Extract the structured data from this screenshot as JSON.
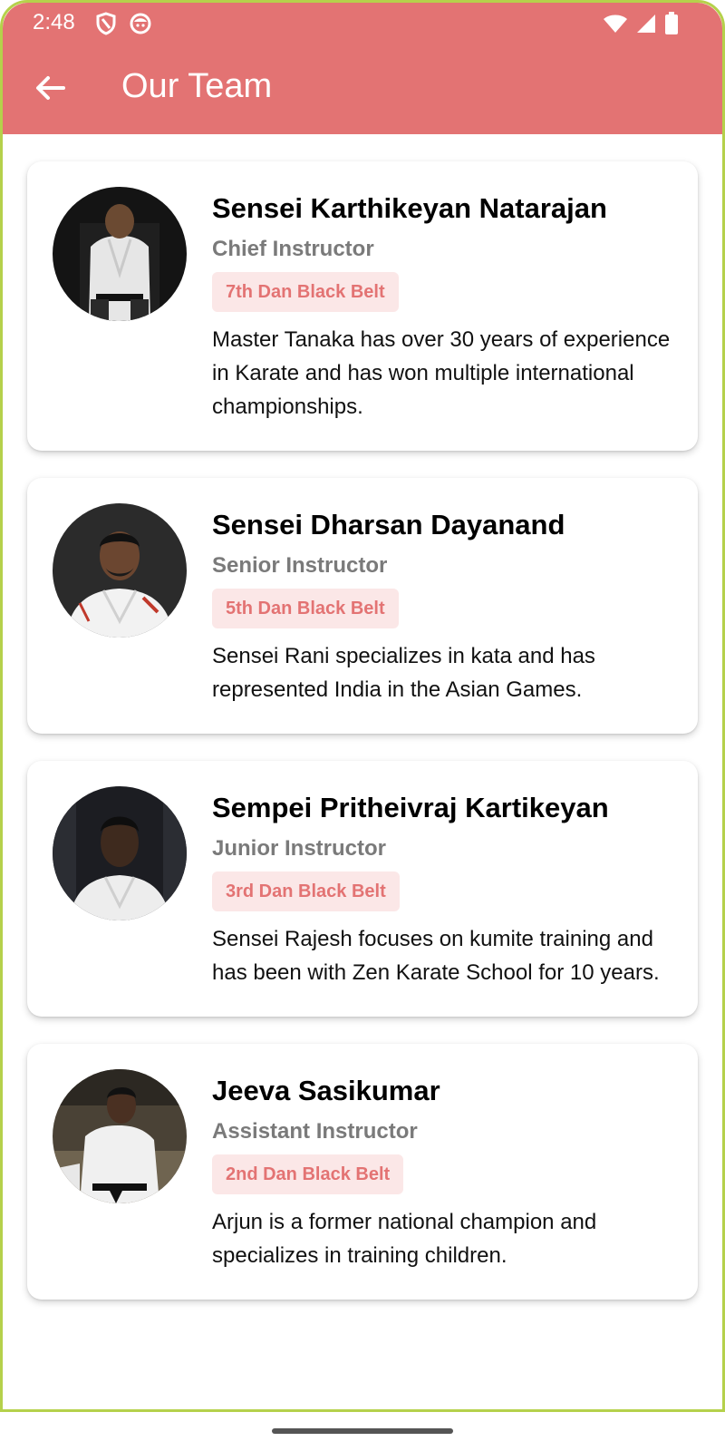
{
  "status_bar": {
    "time": "2:48",
    "icons": [
      "shield-icon",
      "face-icon",
      "wifi-icon",
      "signal-icon",
      "battery-icon"
    ]
  },
  "app_bar": {
    "title": "Our Team",
    "back_icon": "arrow-back-icon",
    "color": "#e37373"
  },
  "team": [
    {
      "name": "Sensei Karthikeyan Natarajan",
      "role": "Chief Instructor",
      "rank": "7th Dan Black Belt",
      "bio": "Master Tanaka has over 30 years of experience in Karate and has won multiple international championships."
    },
    {
      "name": "Sensei Dharsan Dayanand",
      "role": "Senior Instructor",
      "rank": "5th Dan Black Belt",
      "bio": "Sensei Rani specializes in kata and has represented India in the Asian Games."
    },
    {
      "name": "Sempei Pritheivraj Kartikeyan",
      "role": "Junior Instructor",
      "rank": "3rd Dan Black Belt",
      "bio": "Sensei Rajesh focuses on kumite training and has been with Zen Karate School for 10 years."
    },
    {
      "name": "Jeeva Sasikumar",
      "role": "Assistant Instructor",
      "rank": "2nd Dan Black Belt",
      "bio": "Arjun is a former national champion and specializes in training children."
    }
  ],
  "colors": {
    "accent": "#e37373",
    "badge_bg": "#fbe7e7",
    "role_text": "#7a7a7a"
  }
}
